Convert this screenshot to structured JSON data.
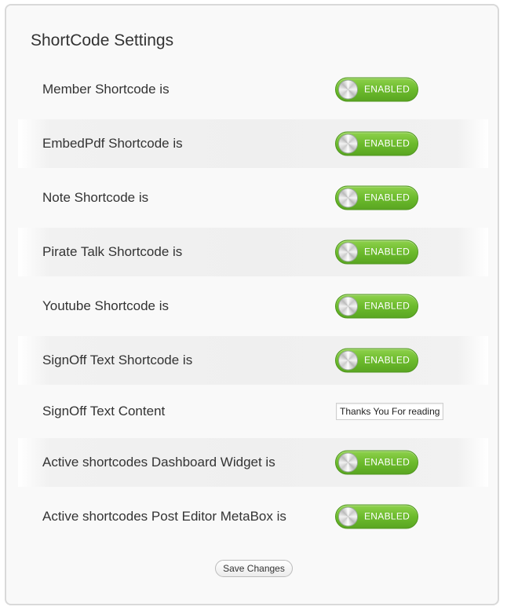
{
  "page": {
    "title": "ShortCode Settings"
  },
  "settings": [
    {
      "label": "Member Shortcode is",
      "type": "toggle",
      "state": "ENABLED"
    },
    {
      "label": "EmbedPdf Shortcode is",
      "type": "toggle",
      "state": "ENABLED"
    },
    {
      "label": "Note Shortcode is",
      "type": "toggle",
      "state": "ENABLED"
    },
    {
      "label": "Pirate Talk Shortcode is",
      "type": "toggle",
      "state": "ENABLED"
    },
    {
      "label": "Youtube Shortcode is",
      "type": "toggle",
      "state": "ENABLED"
    },
    {
      "label": "SignOff Text Shortcode is",
      "type": "toggle",
      "state": "ENABLED"
    },
    {
      "label": "SignOff Text Content",
      "type": "text",
      "value": "Thanks You For reading"
    },
    {
      "label": "Active shortcodes Dashboard Widget is",
      "type": "toggle",
      "state": "ENABLED"
    },
    {
      "label": "Active shortcodes Post Editor MetaBox is",
      "type": "toggle",
      "state": "ENABLED"
    }
  ],
  "actions": {
    "save_label": "Save Changes"
  },
  "colors": {
    "toggle_enabled": "#6cbb2c",
    "panel_background": "#f9f9f9"
  }
}
